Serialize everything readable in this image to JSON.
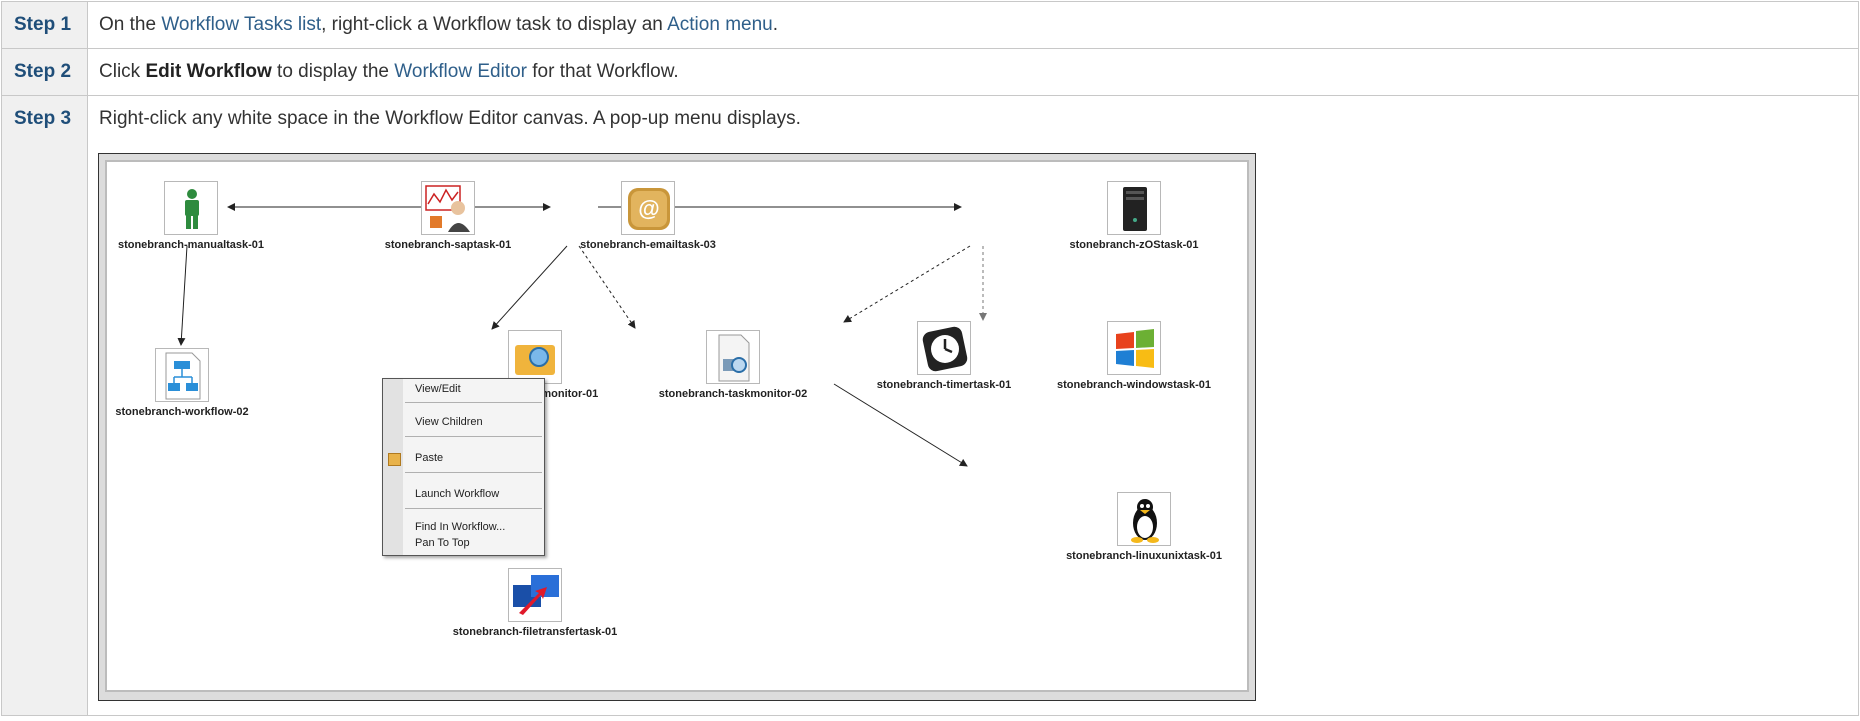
{
  "steps": [
    {
      "label": "Step 1",
      "text_pre": "On the ",
      "link1": "Workflow Tasks list",
      "text_mid": ", right-click a Workflow task to display an ",
      "link2": "Action menu",
      "text_post": "."
    },
    {
      "label": "Step 2",
      "text_pre": "Click ",
      "bold": "Edit Workflow",
      "text_mid": " to display the ",
      "link1": "Workflow Editor",
      "text_post": " for that Workflow."
    },
    {
      "label": "Step 3",
      "text": "Right-click any white space in the Workflow Editor canvas. A pop-up menu displays."
    }
  ],
  "workflow": {
    "nodes": {
      "manualtask": "stonebranch-manualtask-01",
      "saptask": "stonebranch-saptask-01",
      "emailtask": "stonebranch-emailtask-03",
      "zostask": "stonebranch-zOStask-01",
      "workflow02": "stonebranch-workflow-02",
      "filemonitor": "stonebranch-filemonitor-01",
      "taskmonitor": "stonebranch-taskmonitor-02",
      "timertask": "stonebranch-timertask-01",
      "windowstask": "stonebranch-windowstask-01",
      "linuxunixtask": "stonebranch-linuxunixtask-01",
      "filetransfer": "stonebranch-filetransfertask-01"
    },
    "context_menu": {
      "view_edit": "View/Edit",
      "view_children": "View Children",
      "paste": "Paste",
      "launch_workflow": "Launch Workflow",
      "find_in_workflow": "Find In Workflow...",
      "pan_to_top": "Pan To Top"
    }
  },
  "colors": {
    "link": "#2f5f8a",
    "step_label": "#1f4e79"
  }
}
